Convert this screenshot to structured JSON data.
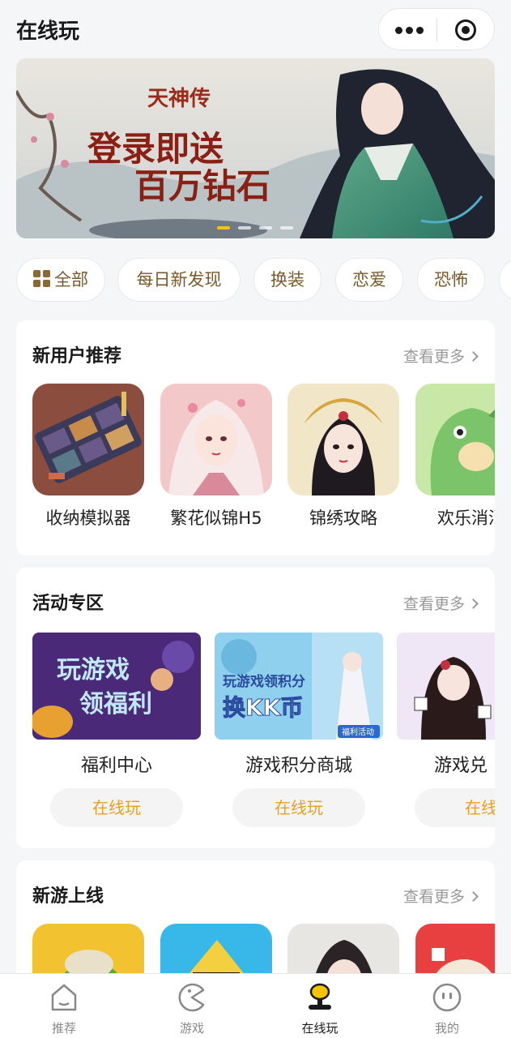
{
  "header": {
    "title": "在线玩"
  },
  "banner": {
    "game_logo": "天神传",
    "slogan_line1": "登录即送",
    "slogan_line2": "百万钻石",
    "slide_count": 4,
    "active_slide": 1
  },
  "categories": [
    {
      "label": "全部",
      "icon": "grid-icon"
    },
    {
      "label": "每日新发现"
    },
    {
      "label": "换装"
    },
    {
      "label": "恋爱"
    },
    {
      "label": "恐怖"
    }
  ],
  "sections": {
    "new_user": {
      "title": "新用户推荐",
      "more": "查看更多",
      "games": [
        "收纳模拟器",
        "繁花似锦H5",
        "锦绣攻略",
        "欢乐消消"
      ]
    },
    "activities": {
      "title": "活动专区",
      "more": "查看更多",
      "items": [
        {
          "name": "福利中心",
          "button": "在线玩",
          "art_text_1": "玩游戏",
          "art_text_2": "领福利"
        },
        {
          "name": "游戏积分商城",
          "button": "在线玩",
          "art_text_1": "玩游戏领积分",
          "art_text_2": "换KK币",
          "tag": "福利活动"
        },
        {
          "name": "游戏兑",
          "button": "在线"
        }
      ]
    },
    "new_games": {
      "title": "新游上线",
      "more": "查看更多"
    }
  },
  "tabbar": {
    "items": [
      {
        "label": "推荐",
        "icon": "home-icon"
      },
      {
        "label": "游戏",
        "icon": "pacman-icon"
      },
      {
        "label": "在线玩",
        "icon": "joystick-icon",
        "active": true
      },
      {
        "label": "我的",
        "icon": "face-icon"
      }
    ]
  },
  "colors": {
    "accent": "#e8a020",
    "active_tab": "#f5c400",
    "chip_text": "#7a5a2a"
  }
}
